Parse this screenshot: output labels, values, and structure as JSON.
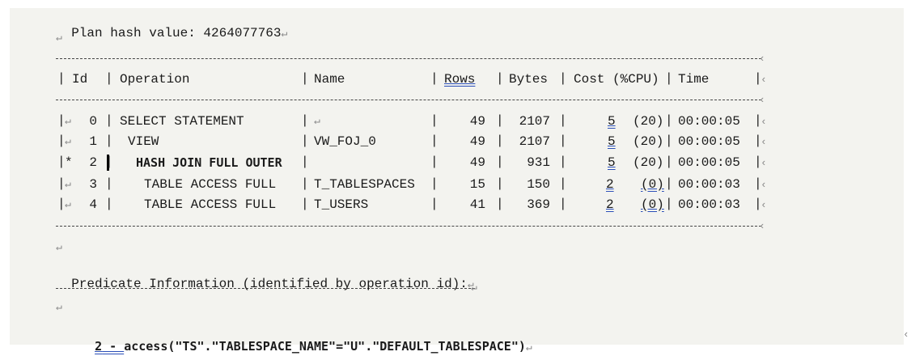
{
  "plan_line": "Plan hash value: 4264077763",
  "paragraph_mark": "↵",
  "cell_mark": "‹",
  "headers": {
    "id": "Id",
    "operation": "Operation",
    "name": "Name",
    "rows": "Rows",
    "bytes": "Bytes",
    "cost": "Cost (%CPU)",
    "time": "Time"
  },
  "rows": [
    {
      "marker": "↵",
      "id": "0",
      "operation": "SELECT STATEMENT",
      "name": "↵",
      "rows": "49",
      "bytes": "2107",
      "cost": "5",
      "cpu": "(20)",
      "time": "00:00:05"
    },
    {
      "marker": "↵",
      "id": "1",
      "operation": "VIEW",
      "name": "VW_FOJ_0",
      "rows": "49",
      "bytes": "2107",
      "cost": "5",
      "cpu": "(20)",
      "time": "00:00:05"
    },
    {
      "marker": "*",
      "id": "2",
      "operation": "HASH JOIN FULL OUTER",
      "name": "",
      "rows": "49",
      "bytes": "931",
      "cost": "5",
      "cpu": "(20)",
      "time": "00:00:05"
    },
    {
      "marker": "↵",
      "id": "3",
      "operation": "TABLE ACCESS FULL",
      "name": "T_TABLESPACES",
      "rows": "15",
      "bytes": "150",
      "cost": "2",
      "cpu": "(0)",
      "time": "00:00:03"
    },
    {
      "marker": "↵",
      "id": "4",
      "operation": "TABLE ACCESS FULL",
      "name": "T_USERS",
      "rows": "41",
      "bytes": "369",
      "cost": "2",
      "cpu": "(0)",
      "time": "00:00:03"
    }
  ],
  "predicate_heading": "Predicate Information (identified by operation id):",
  "predicate": {
    "id": "2",
    "sep": " - ",
    "text": "access(\"TS\".\"TABLESPACE_NAME\"=\"U\".\"DEFAULT_TABLESPACE\")"
  }
}
